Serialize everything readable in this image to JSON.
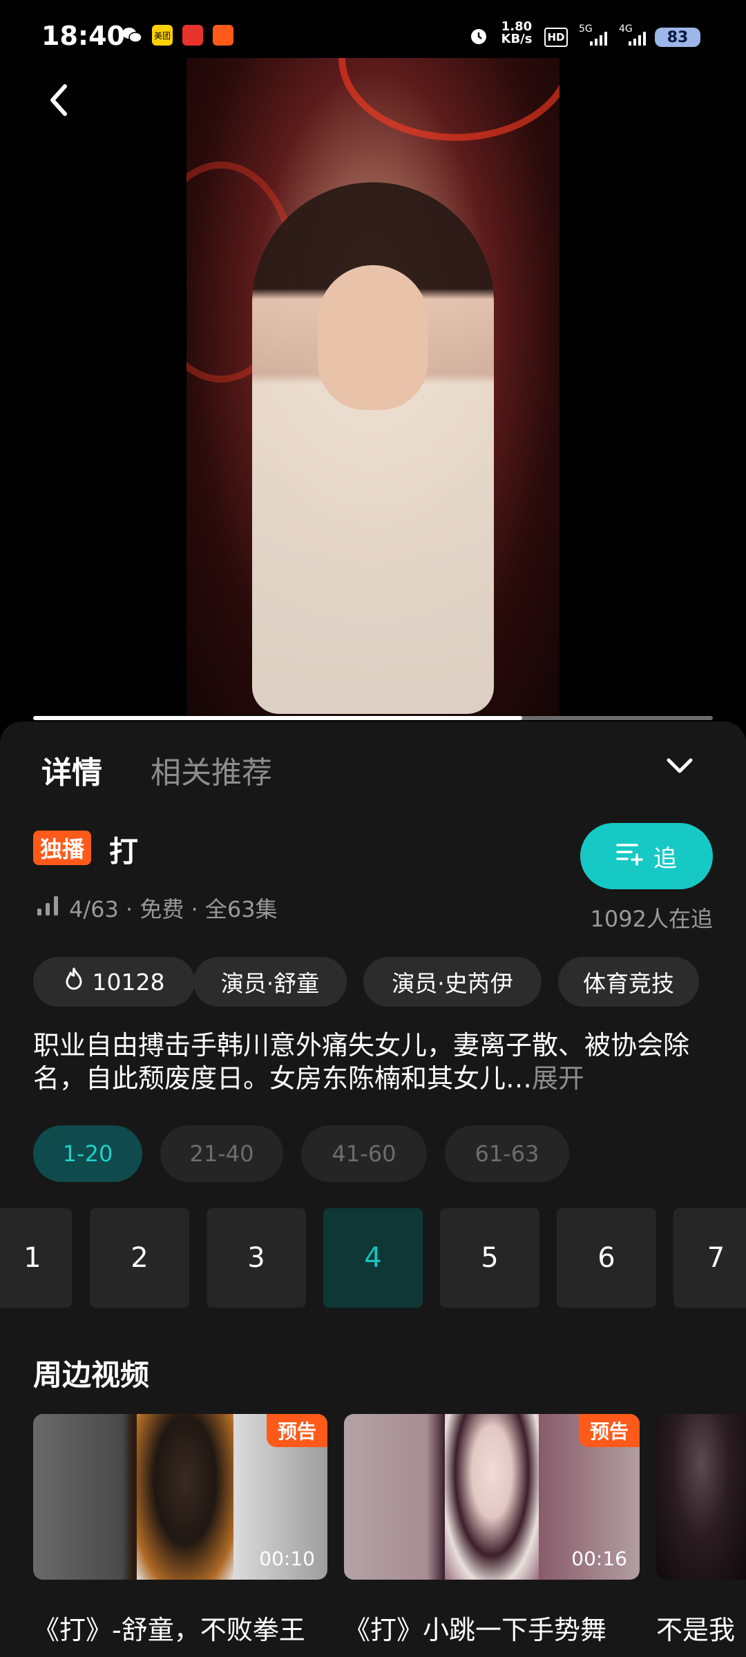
{
  "status_bar": {
    "time": "18:40",
    "app_icons": [
      "wechat-icon",
      "meituan-icon",
      "app-icon",
      "app-icon"
    ],
    "meituan_label": "美团",
    "net_speed": "1.80\nKB/s",
    "hd_label": "HD",
    "signal_5g": "5G",
    "signal_4g": "4G",
    "battery": "83"
  },
  "player": {
    "progress_fraction": 0.72
  },
  "tabs": [
    {
      "label": "详情"
    },
    {
      "label": "相关推荐"
    }
  ],
  "show": {
    "badge": "独播",
    "title": "打",
    "meta": "4/63 · 免费 · 全63集",
    "follow_label": "追",
    "followers": "1092人在追"
  },
  "chips": [
    {
      "label": "10128",
      "icon": "flame-icon"
    },
    {
      "label": "演员·舒童"
    },
    {
      "label": "演员·史芮伊"
    },
    {
      "label": "体育竞技"
    }
  ],
  "description": {
    "text": "职业自由搏击手韩川意外痛失女儿，妻离子散、被协会除名，自此颓废度日。女房东陈楠和其女儿…",
    "expand": "展开"
  },
  "episode_ranges": [
    {
      "label": "1-20",
      "active": true
    },
    {
      "label": "21-40"
    },
    {
      "label": "41-60"
    },
    {
      "label": "61-63"
    }
  ],
  "episodes": [
    "1",
    "2",
    "3",
    "4",
    "5",
    "6",
    "7"
  ],
  "active_episode": "4",
  "related": {
    "title": "周边视频",
    "items": [
      {
        "tag": "预告",
        "duration": "00:10",
        "title": "《打》-舒童，不败拳王"
      },
      {
        "tag": "预告",
        "duration": "00:16",
        "title": "《打》小跳一下手势舞"
      },
      {
        "title": "不是我"
      }
    ]
  },
  "colors": {
    "accent": "#16c9c5",
    "badge": "#ff5a1a",
    "sheet": "#171717"
  }
}
